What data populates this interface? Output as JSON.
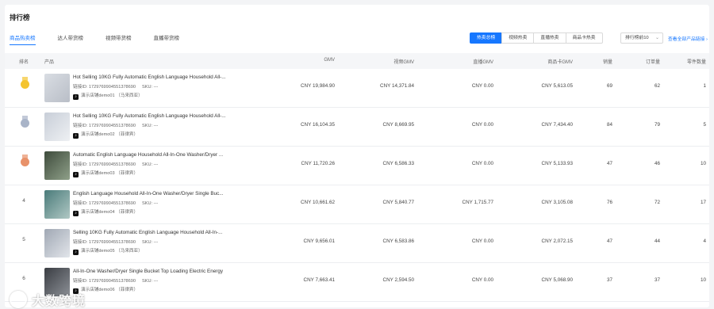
{
  "page": {
    "title": "排行榜"
  },
  "tabs": [
    {
      "label": "商品热卖榜",
      "active": true
    },
    {
      "label": "达人带货榜",
      "active": false
    },
    {
      "label": "视频带货榜",
      "active": false
    },
    {
      "label": "直播带货榜",
      "active": false
    }
  ],
  "segment": [
    {
      "label": "热卖总榜",
      "active": true
    },
    {
      "label": "视频热卖",
      "active": false
    },
    {
      "label": "直播热卖",
      "active": false
    },
    {
      "label": "商品卡热卖",
      "active": false
    }
  ],
  "rank_select": {
    "value": "排行榜前10",
    "icon": "chevron-down-icon"
  },
  "view_all_link": "查看全部产品链接 ›",
  "table": {
    "columns": [
      "排名",
      "产品",
      "GMV",
      "视频GMV",
      "直播GMV",
      "商品卡GMV",
      "销量",
      "订单量",
      "零件数量"
    ],
    "rows": [
      {
        "rank": "1",
        "medal": "gold",
        "name": "Hot Selling 10KG Fully Automatic English Language Household All-...",
        "link_id": "链接ID: 1729769904551378690",
        "sku": "SKU: ---",
        "shop": "演示店铺demo01 （马来西亚）",
        "gmv": "CNY 19,984.90",
        "video_gmv": "CNY 14,371.84",
        "live_gmv": "CNY 0.00",
        "card_gmv": "CNY 5,613.05",
        "sales": "69",
        "orders": "62",
        "parts": "1"
      },
      {
        "rank": "2",
        "medal": "silver",
        "name": "Hot Selling 10KG Fully Automatic English Language Household All-...",
        "link_id": "链接ID: 1729769904551378690",
        "sku": "SKU: ---",
        "shop": "演示店铺demo02 （菲律宾）",
        "gmv": "CNY 16,104.35",
        "video_gmv": "CNY 8,669.95",
        "live_gmv": "CNY 0.00",
        "card_gmv": "CNY 7,434.40",
        "sales": "84",
        "orders": "79",
        "parts": "5"
      },
      {
        "rank": "3",
        "medal": "bronze",
        "name": "Automatic English Language Household All-In-One Washer/Dryer ...",
        "link_id": "链接ID: 1729769904551378690",
        "sku": "SKU: ---",
        "shop": "演示店铺demo03 （菲律宾）",
        "gmv": "CNY 11,720.26",
        "video_gmv": "CNY 6,586.33",
        "live_gmv": "CNY 0.00",
        "card_gmv": "CNY 5,133.93",
        "sales": "47",
        "orders": "46",
        "parts": "10"
      },
      {
        "rank": "4",
        "medal": "",
        "name": "English Language Household All-In-One Washer/Dryer Single Buc...",
        "link_id": "链接ID: 1729769904551378690",
        "sku": "SKU: ---",
        "shop": "演示店铺demo04 （菲律宾）",
        "gmv": "CNY 10,661.62",
        "video_gmv": "CNY 5,840.77",
        "live_gmv": "CNY 1,715.77",
        "card_gmv": "CNY 3,105.08",
        "sales": "76",
        "orders": "72",
        "parts": "17"
      },
      {
        "rank": "5",
        "medal": "",
        "name": "Selling 10KG Fully Automatic English Language Household All-In-...",
        "link_id": "链接ID: 1729769904551378690",
        "sku": "SKU: ---",
        "shop": "演示店铺demo05 （马来西亚）",
        "gmv": "CNY 9,656.01",
        "video_gmv": "CNY 6,583.86",
        "live_gmv": "CNY 0.00",
        "card_gmv": "CNY 2,072.15",
        "sales": "47",
        "orders": "44",
        "parts": "4"
      },
      {
        "rank": "6",
        "medal": "",
        "name": "All-In-One Washer/Dryer Single Bucket Top Loading Electric Energy",
        "link_id": "链接ID: 1729769904551378690",
        "sku": "SKU: ---",
        "shop": "演示店铺demo06 （菲律宾）",
        "gmv": "CNY 7,663.41",
        "video_gmv": "CNY 2,594.50",
        "live_gmv": "CNY 0.00",
        "card_gmv": "CNY 5,068.90",
        "sales": "37",
        "orders": "37",
        "parts": "10"
      }
    ]
  },
  "watermark": "大数跨境",
  "colors": {
    "accent": "#1677ff",
    "gold": "#f4c430",
    "silver": "#a9b4c8",
    "bronze": "#e8926a"
  }
}
